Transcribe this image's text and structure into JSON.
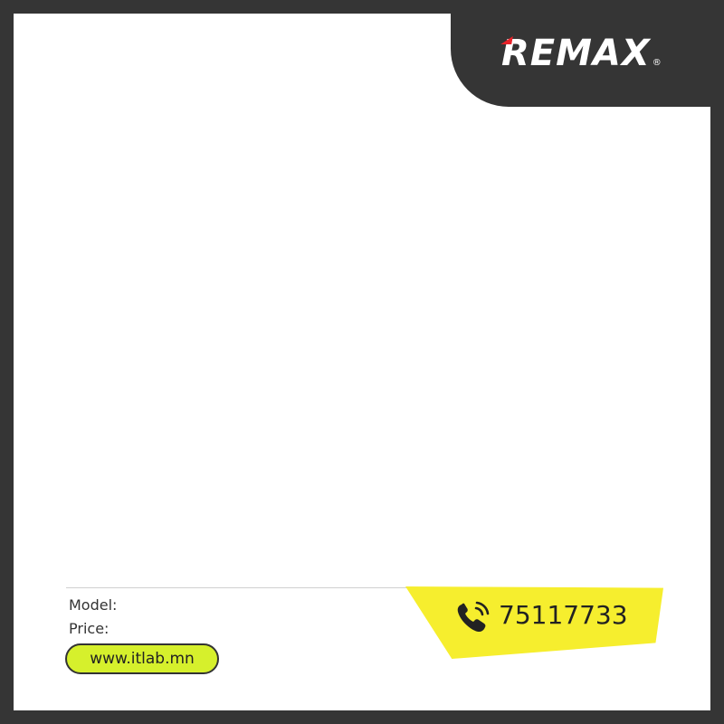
{
  "brand": {
    "name": "REMAX",
    "registered_mark": "®"
  },
  "product_info": {
    "model_label": "Model:",
    "price_label": "Price:"
  },
  "contact": {
    "website": "www.itlab.mn",
    "phone": "75117733",
    "phone_icon": "phone-ringing-icon"
  },
  "colors": {
    "frame": "#353535",
    "accent_red": "#e8232a",
    "website_pill": "#d6f02c",
    "phone_banner": "#f6ee2e"
  }
}
